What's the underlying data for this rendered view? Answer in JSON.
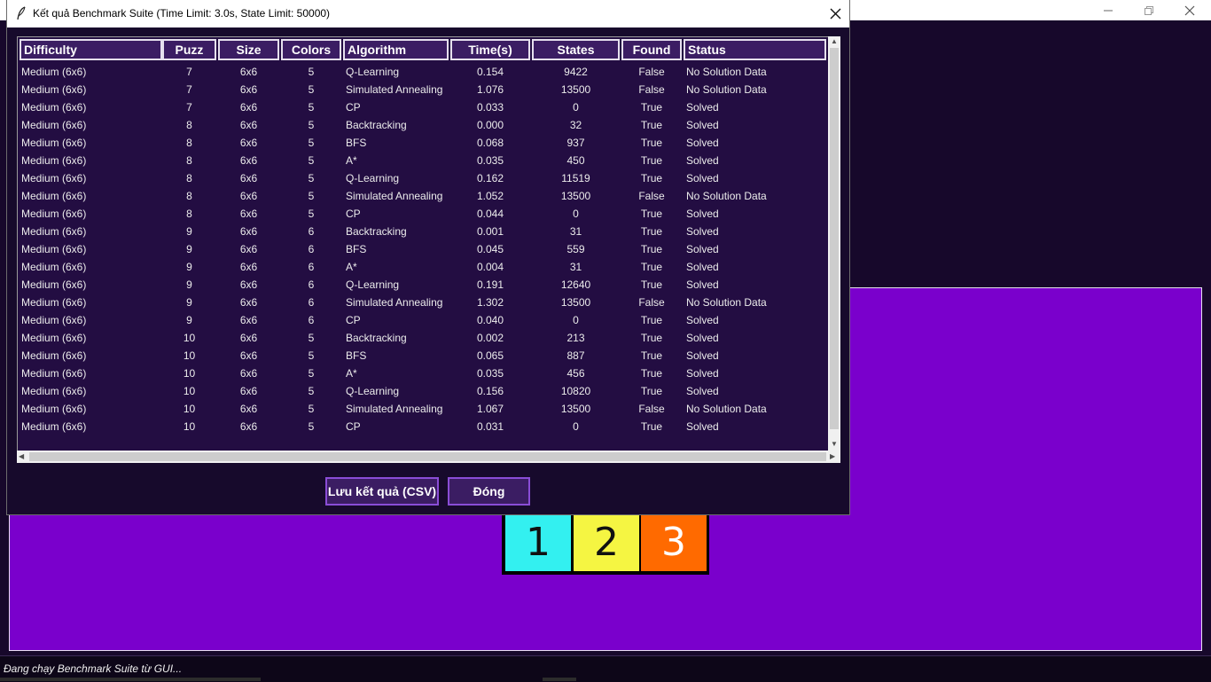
{
  "dialog": {
    "title": "Kết quả Benchmark Suite (Time Limit: 3.0s, State Limit: 50000)",
    "save_button": "Lưu kết quả (CSV)",
    "close_button": "Đóng"
  },
  "table": {
    "columns": [
      "Difficulty",
      "Puzz",
      "Size",
      "Colors",
      "Algorithm",
      "Time(s)",
      "States",
      "Found",
      "Status"
    ],
    "rows": [
      [
        "Medium (6x6)",
        "7",
        "6x6",
        "5",
        "Q-Learning",
        "0.154",
        "9422",
        "False",
        "No Solution Data"
      ],
      [
        "Medium (6x6)",
        "7",
        "6x6",
        "5",
        "Simulated Annealing",
        "1.076",
        "13500",
        "False",
        "No Solution Data"
      ],
      [
        "Medium (6x6)",
        "7",
        "6x6",
        "5",
        "CP",
        "0.033",
        "0",
        "True",
        "Solved"
      ],
      [
        "Medium (6x6)",
        "8",
        "6x6",
        "5",
        "Backtracking",
        "0.000",
        "32",
        "True",
        "Solved"
      ],
      [
        "Medium (6x6)",
        "8",
        "6x6",
        "5",
        "BFS",
        "0.068",
        "937",
        "True",
        "Solved"
      ],
      [
        "Medium (6x6)",
        "8",
        "6x6",
        "5",
        "A*",
        "0.035",
        "450",
        "True",
        "Solved"
      ],
      [
        "Medium (6x6)",
        "8",
        "6x6",
        "5",
        "Q-Learning",
        "0.162",
        "11519",
        "True",
        "Solved"
      ],
      [
        "Medium (6x6)",
        "8",
        "6x6",
        "5",
        "Simulated Annealing",
        "1.052",
        "13500",
        "False",
        "No Solution Data"
      ],
      [
        "Medium (6x6)",
        "8",
        "6x6",
        "5",
        "CP",
        "0.044",
        "0",
        "True",
        "Solved"
      ],
      [
        "Medium (6x6)",
        "9",
        "6x6",
        "6",
        "Backtracking",
        "0.001",
        "31",
        "True",
        "Solved"
      ],
      [
        "Medium (6x6)",
        "9",
        "6x6",
        "6",
        "BFS",
        "0.045",
        "559",
        "True",
        "Solved"
      ],
      [
        "Medium (6x6)",
        "9",
        "6x6",
        "6",
        "A*",
        "0.004",
        "31",
        "True",
        "Solved"
      ],
      [
        "Medium (6x6)",
        "9",
        "6x6",
        "6",
        "Q-Learning",
        "0.191",
        "12640",
        "True",
        "Solved"
      ],
      [
        "Medium (6x6)",
        "9",
        "6x6",
        "6",
        "Simulated Annealing",
        "1.302",
        "13500",
        "False",
        "No Solution Data"
      ],
      [
        "Medium (6x6)",
        "9",
        "6x6",
        "6",
        "CP",
        "0.040",
        "0",
        "True",
        "Solved"
      ],
      [
        "Medium (6x6)",
        "10",
        "6x6",
        "5",
        "Backtracking",
        "0.002",
        "213",
        "True",
        "Solved"
      ],
      [
        "Medium (6x6)",
        "10",
        "6x6",
        "5",
        "BFS",
        "0.065",
        "887",
        "True",
        "Solved"
      ],
      [
        "Medium (6x6)",
        "10",
        "6x6",
        "5",
        "A*",
        "0.035",
        "456",
        "True",
        "Solved"
      ],
      [
        "Medium (6x6)",
        "10",
        "6x6",
        "5",
        "Q-Learning",
        "0.156",
        "10820",
        "True",
        "Solved"
      ],
      [
        "Medium (6x6)",
        "10",
        "6x6",
        "5",
        "Simulated Annealing",
        "1.067",
        "13500",
        "False",
        "No Solution Data"
      ],
      [
        "Medium (6x6)",
        "10",
        "6x6",
        "5",
        "CP",
        "0.031",
        "0",
        "True",
        "Solved"
      ]
    ]
  },
  "board": {
    "tiles": [
      {
        "label": "1",
        "color": "#33f0f0",
        "text_color": "#111111"
      },
      {
        "label": "2",
        "color": "#f5f542",
        "text_color": "#111111"
      },
      {
        "label": "3",
        "color": "#ff6a00",
        "text_color": "#ffffff"
      }
    ],
    "panel_color": "#7a00cc"
  },
  "status_bar": {
    "text": "Đang chạy Benchmark Suite từ GUI..."
  },
  "icons": {
    "dialog_icon": "feather-icon",
    "close": "close-icon",
    "minimize": "minimize-icon",
    "maximize": "maximize-icon"
  }
}
